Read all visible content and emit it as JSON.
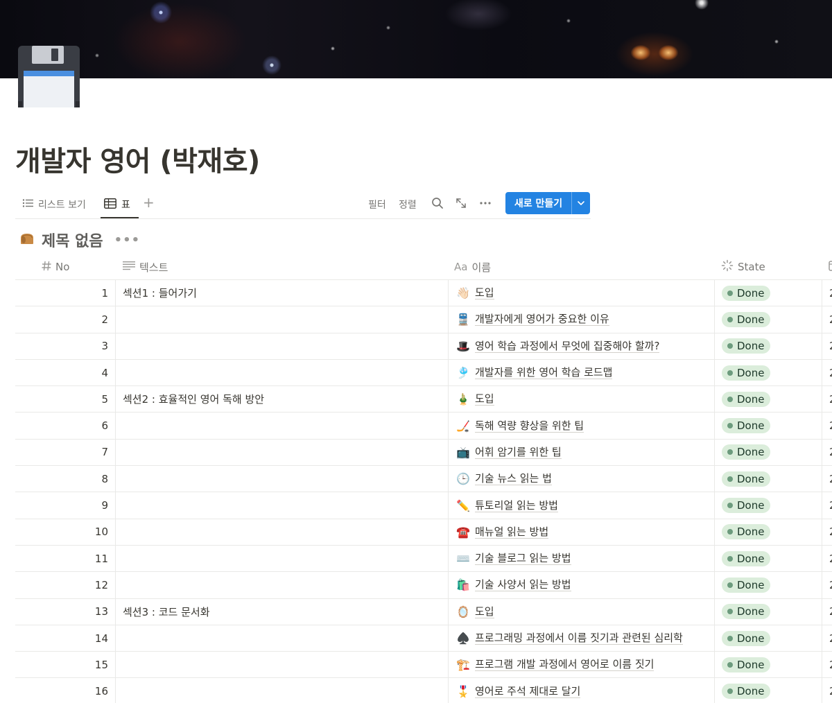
{
  "page": {
    "title": "개발자 영어 (박재호)",
    "icon": "floppy-disk-icon"
  },
  "views": {
    "list_label": "리스트 보기",
    "table_label": "표",
    "active": "표"
  },
  "toolbar": {
    "filter_label": "필터",
    "sort_label": "정렬",
    "new_label": "새로 만들기"
  },
  "database": {
    "title": "제목 없음",
    "icon": "bread-icon"
  },
  "columns": {
    "no": "No",
    "text": "텍스트",
    "name_prefix": "Aa",
    "name": "이름",
    "state": "State",
    "next_partial": "2"
  },
  "colors": {
    "accent": "#2383e2",
    "done_bg": "#dbeddb",
    "done_dot": "#6c9b7d",
    "text": "#37352f"
  },
  "rows": [
    {
      "no": "1",
      "text": "섹션1 : 들어가기",
      "emoji": "👋🏻",
      "icon": "waving-hand-icon",
      "name": "도입",
      "state": "Done",
      "next": "2"
    },
    {
      "no": "2",
      "text": "",
      "emoji": "🚆",
      "icon": "train-icon",
      "name": "개발자에게 영어가 중요한 이유",
      "state": "Done",
      "next": "2"
    },
    {
      "no": "3",
      "text": "",
      "emoji": "🎩",
      "icon": "top-hat-icon",
      "name": "영어 학습 과정에서 무엇에 집중해야 할까?",
      "state": "Done",
      "next": "2"
    },
    {
      "no": "4",
      "text": "",
      "emoji": "🎐",
      "icon": "wind-chime-icon",
      "name": "개발자를 위한 영어 학습 로드맵",
      "state": "Done",
      "next": "2"
    },
    {
      "no": "5",
      "text": "섹션2 : 효율적인 영어 독해 방안",
      "emoji": "🎍",
      "icon": "pine-decoration-icon",
      "name": "도입",
      "state": "Done",
      "next": "2"
    },
    {
      "no": "6",
      "text": "",
      "emoji": "🏒",
      "icon": "hockey-stick-icon",
      "name": "독해 역량 향상을 위한 팁",
      "state": "Done",
      "next": "2"
    },
    {
      "no": "7",
      "text": "",
      "emoji": "📺",
      "icon": "television-icon",
      "name": "어휘 암기를 위한 팁",
      "state": "Done",
      "next": "2"
    },
    {
      "no": "8",
      "text": "",
      "emoji": "🕒",
      "icon": "clock-icon",
      "name": "기술 뉴스 읽는 법",
      "state": "Done",
      "next": "2"
    },
    {
      "no": "9",
      "text": "",
      "emoji": "✏️",
      "icon": "pencil-icon",
      "name": "튜토리얼 읽는 방법",
      "state": "Done",
      "next": "2"
    },
    {
      "no": "10",
      "text": "",
      "emoji": "☎️",
      "icon": "telephone-icon",
      "name": "매뉴얼 읽는 방법",
      "state": "Done",
      "next": "2"
    },
    {
      "no": "11",
      "text": "",
      "emoji": "⌨️",
      "icon": "keyboard-icon",
      "name": "기술 블로그 읽는 방법",
      "state": "Done",
      "next": "2"
    },
    {
      "no": "12",
      "text": "",
      "emoji": "🛍️",
      "icon": "shopping-bags-icon",
      "name": "기술 사양서 읽는 방법",
      "state": "Done",
      "next": "2"
    },
    {
      "no": "13",
      "text": "섹션3 : 코드 문서화",
      "emoji": "🪞",
      "icon": "mirror-icon",
      "name": "도입",
      "state": "Done",
      "next": "2"
    },
    {
      "no": "14",
      "text": "",
      "emoji": "♠️",
      "icon": "spade-icon",
      "name": "프로그래밍 과정에서 이름 짓기과 관련된 심리학",
      "state": "Done",
      "next": "2"
    },
    {
      "no": "15",
      "text": "",
      "emoji": "🏗️",
      "icon": "crane-icon",
      "name": "프로그램 개발 과정에서 영어로 이름 짓기",
      "state": "Done",
      "next": "2"
    },
    {
      "no": "16",
      "text": "",
      "emoji": "🎖️",
      "icon": "medal-icon",
      "name": "영어로 주석 제대로 달기",
      "state": "Done",
      "next": "2"
    }
  ]
}
